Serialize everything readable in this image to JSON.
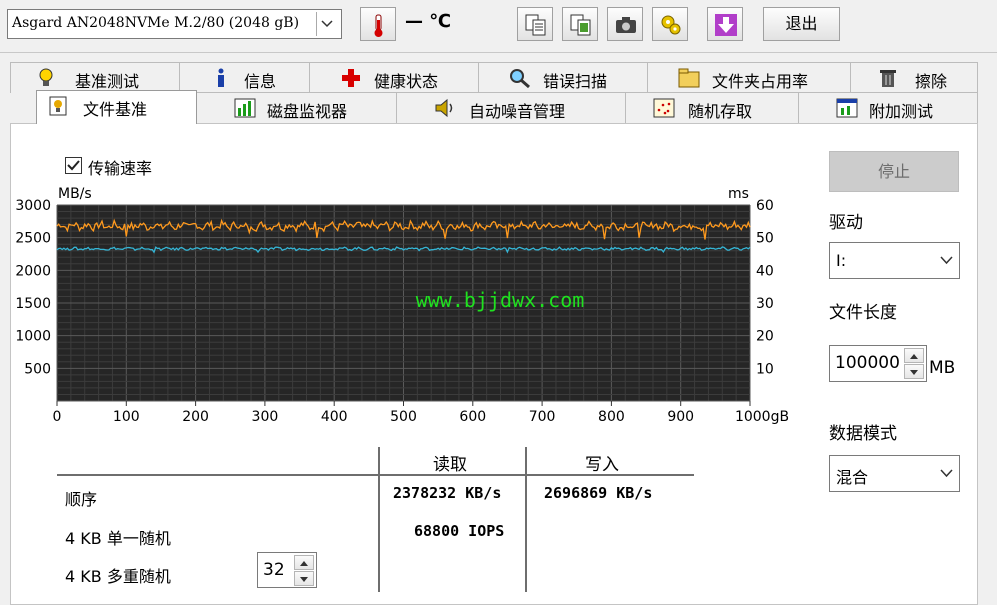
{
  "toolbar": {
    "drive_selected": "Asgard AN2048NVMe M.2/80 (2048 gB)",
    "temperature": "— ℃",
    "exit_label": "退出"
  },
  "tabs_row1": [
    {
      "label": "基准测试",
      "icon": "lightbulb-icon"
    },
    {
      "label": "信息",
      "icon": "info-icon"
    },
    {
      "label": "健康状态",
      "icon": "health-cross-icon"
    },
    {
      "label": "错误扫描",
      "icon": "magnifier-icon"
    },
    {
      "label": "文件夹占用率",
      "icon": "folder-icon"
    },
    {
      "label": "擦除",
      "icon": "trash-icon"
    }
  ],
  "tabs_row2": [
    {
      "label": "文件基准",
      "icon": "file-bench-icon",
      "active": true
    },
    {
      "label": "磁盘监视器",
      "icon": "bar-chart-icon"
    },
    {
      "label": "自动噪音管理",
      "icon": "speaker-icon"
    },
    {
      "label": "随机存取",
      "icon": "random-access-icon"
    },
    {
      "label": "附加测试",
      "icon": "extra-test-icon"
    }
  ],
  "options": {
    "transfer_rate_label": "传输速率",
    "transfer_rate_checked": true
  },
  "chart_data": {
    "type": "line",
    "left_axis_unit": "MB/s",
    "right_axis_unit": "ms",
    "watermark": "www.bjjdwx.com",
    "x_ticks": [
      "0",
      "100",
      "200",
      "300",
      "400",
      "500",
      "600",
      "700",
      "800",
      "900",
      "1000gB"
    ],
    "y_left_ticks": [
      "3000",
      "2500",
      "2000",
      "1500",
      "1000",
      "500"
    ],
    "y_right_ticks": [
      "60",
      "50",
      "40",
      "30",
      "20",
      "10"
    ],
    "xlim": [
      0,
      1000
    ],
    "ylim_left": [
      0,
      3000
    ],
    "ylim_right": [
      0,
      60
    ],
    "grid": true,
    "series": [
      {
        "name": "写入",
        "color": "#ff9a1e",
        "approx_value": 2680
      },
      {
        "name": "读取",
        "color": "#35b6d6",
        "approx_value": 2330
      }
    ]
  },
  "right_panel": {
    "stop_label": "停止",
    "drive_label": "驱动",
    "drive_value": "I:",
    "length_label": "文件长度",
    "length_value": "100000",
    "length_unit": "MB",
    "mode_label": "数据模式",
    "mode_value": "混合"
  },
  "results": {
    "col_read": "读取",
    "col_write": "写入",
    "rows": [
      {
        "label": "顺序",
        "read": "2378232 KB/s",
        "write": "2696869 KB/s"
      },
      {
        "label": "4 KB 单一随机",
        "read": "68800 IOPS",
        "write": ""
      },
      {
        "label": "4 KB 多重随机",
        "read": "",
        "write": ""
      }
    ],
    "queue_depth": "32"
  }
}
